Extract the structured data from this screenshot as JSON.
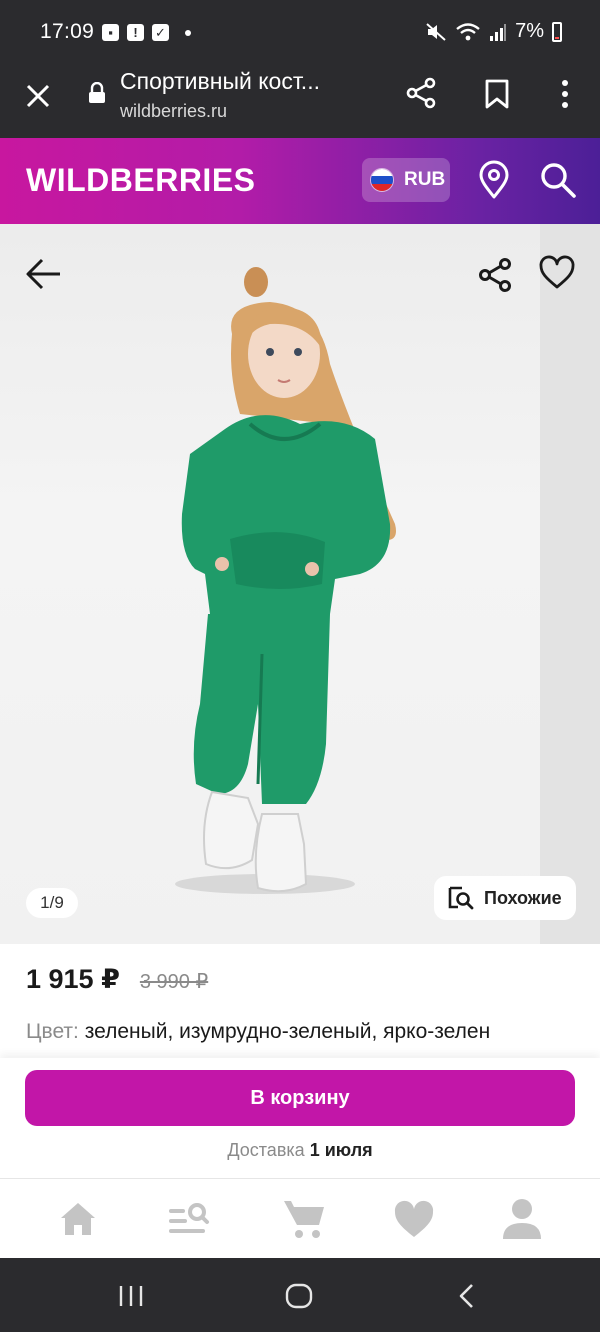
{
  "status_bar": {
    "time": "17:09",
    "battery": "7%"
  },
  "browser": {
    "page_title": "Спортивный кост...",
    "url": "wildberries.ru"
  },
  "header": {
    "logo": "WILDBERRIES",
    "currency": "RUB",
    "colors": {
      "gradient_start": "#c8179f",
      "gradient_end": "#4c1f97"
    }
  },
  "gallery": {
    "counter": "1/9",
    "similar_label": "Похожие"
  },
  "product": {
    "price": "1 915 ₽",
    "old_price": "3 990 ₽",
    "color_label": "Цвет:",
    "color_value": " зеленый, изумрудно-зеленый, ярко-зелен"
  },
  "actions": {
    "cart_label": "В корзину",
    "delivery_label": "Доставка",
    "delivery_date": "1 июля",
    "accent": "#c216a8"
  },
  "bottom_nav": {
    "items": [
      "home-icon",
      "catalog-search-icon",
      "cart-icon",
      "favorites-icon",
      "profile-icon"
    ]
  }
}
